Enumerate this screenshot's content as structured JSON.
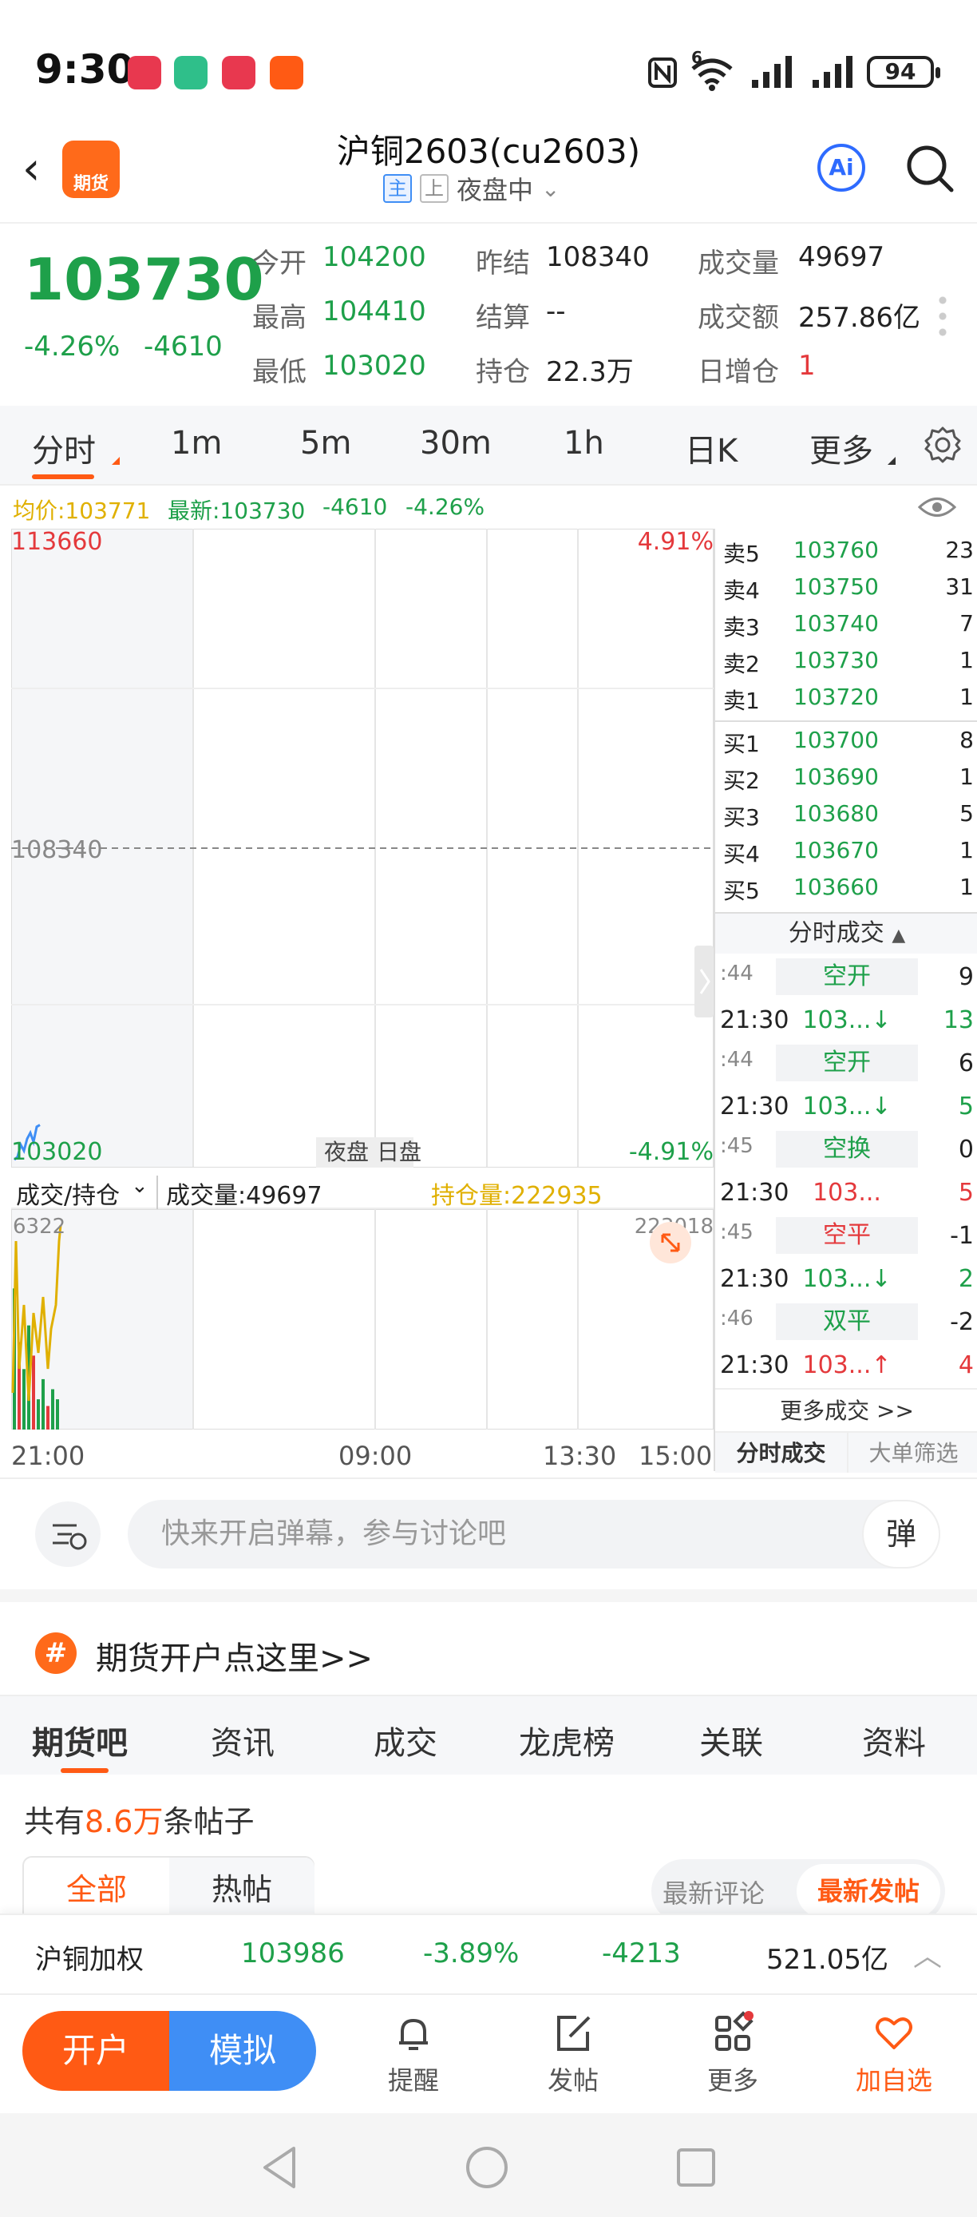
{
  "status": {
    "time": "9:30",
    "signal": "6",
    "battery": "94"
  },
  "header": {
    "logo_text": "期货",
    "title": "沪铜2603(cu2603)",
    "tag_main": "主",
    "tag_exchange": "上",
    "session": "夜盘中",
    "ai_label": "Ai"
  },
  "quote": {
    "price": "103730",
    "change_pct": "-4.26%",
    "change_abs": "-4610",
    "fields": [
      {
        "label": "今开",
        "value": "104200"
      },
      {
        "label": "昨结",
        "value": "108340"
      },
      {
        "label": "成交量",
        "value": "49697"
      },
      {
        "label": "最高",
        "value": "104410"
      },
      {
        "label": "结算",
        "value": "--"
      },
      {
        "label": "成交额",
        "value": "257.86亿"
      },
      {
        "label": "最低",
        "value": "103020"
      },
      {
        "label": "持仓",
        "value": "22.3万"
      },
      {
        "label": "日增仓",
        "value": "1"
      }
    ]
  },
  "chart_tabs": [
    "分时",
    "1m",
    "5m",
    "30m",
    "1h",
    "日K",
    "更多"
  ],
  "info_line": {
    "avg": "均价:103771",
    "latest": "最新:103730",
    "chg": "-4610",
    "pct": "-4.26%"
  },
  "chart": {
    "top_price": "113660",
    "top_pct": "4.91%",
    "mid_price": "108340",
    "bottom_price": "103020",
    "bottom_pct": "-4.91%",
    "session_night": "夜盘",
    "session_day": "日盘",
    "vol_selector": "成交/持仓",
    "vol_label": "成交量:49697",
    "oi_label": "持仓量:222935",
    "vol_max": "6322",
    "oi_max": "223018",
    "x_labels": [
      "21:00",
      "09:00",
      "13:30",
      "15:00"
    ]
  },
  "chart_data": {
    "type": "line",
    "title": "",
    "x": [
      "21:00",
      "09:00",
      "13:30",
      "15:00"
    ],
    "series": [
      {
        "values": [
          103150,
          103200,
          103400,
          103300,
          103500,
          103600,
          103450,
          103700,
          103730
        ]
      }
    ],
    "ylim": [
      103020,
      113660
    ],
    "reference": 108340,
    "volume": [
      4200,
      2600,
      1800,
      3100,
      2200,
      900,
      1500,
      700,
      1200,
      900
    ],
    "volume_ylim": [
      0,
      6322
    ]
  },
  "order_book": {
    "asks": [
      {
        "label": "卖5",
        "price": "103760",
        "vol": "23"
      },
      {
        "label": "卖4",
        "price": "103750",
        "vol": "31"
      },
      {
        "label": "卖3",
        "price": "103740",
        "vol": "7"
      },
      {
        "label": "卖2",
        "price": "103730",
        "vol": "1"
      },
      {
        "label": "卖1",
        "price": "103720",
        "vol": "1"
      }
    ],
    "bids": [
      {
        "label": "买1",
        "price": "103700",
        "vol": "8"
      },
      {
        "label": "买2",
        "price": "103690",
        "vol": "1"
      },
      {
        "label": "买3",
        "price": "103680",
        "vol": "5"
      },
      {
        "label": "买4",
        "price": "103670",
        "vol": "1"
      },
      {
        "label": "买5",
        "price": "103660",
        "vol": "1"
      }
    ]
  },
  "trades": {
    "title": "分时成交",
    "rows": [
      {
        "t": ":44",
        "p": "空开",
        "v": "9"
      },
      {
        "t": "21:30",
        "p": "103...↓",
        "v": "13"
      },
      {
        "t": ":44",
        "p": "空开",
        "v": "6"
      },
      {
        "t": "21:30",
        "p": "103...↓",
        "v": "5"
      },
      {
        "t": ":45",
        "p": "空换",
        "v": "0"
      },
      {
        "t": "21:30",
        "p": "103...",
        "v": "5"
      },
      {
        "t": ":45",
        "p": "空平",
        "v": "-1"
      },
      {
        "t": "21:30",
        "p": "103...↓",
        "v": "2"
      },
      {
        "t": ":46",
        "p": "双平",
        "v": "-2"
      },
      {
        "t": "21:30",
        "p": "103...↑",
        "v": "4"
      }
    ],
    "more": "更多成交 >>",
    "tab_trades": "分时成交",
    "tab_filter": "大单筛选"
  },
  "comment": {
    "placeholder": "快来开启弹幕，参与讨论吧",
    "danmu": "弹"
  },
  "banner": {
    "icon": "#",
    "text": "期货开户点这里>>"
  },
  "community_tabs": [
    "期货吧",
    "资讯",
    "成交",
    "龙虎榜",
    "关联",
    "资料"
  ],
  "posts": {
    "prefix": "共有",
    "count": "8.6万",
    "suffix": "条帖子",
    "filter_all": "全部",
    "filter_hot": "热帖",
    "sort_comment": "最新评论",
    "sort_post": "最新发帖"
  },
  "ticker": {
    "name": "沪铜加权",
    "price": "103986",
    "pct": "-3.89%",
    "chg": "-4213",
    "amount": "521.05亿"
  },
  "toolbar": {
    "open": "开户",
    "demo": "模拟",
    "remind": "提醒",
    "post": "发帖",
    "more": "更多",
    "watch": "加自选"
  }
}
